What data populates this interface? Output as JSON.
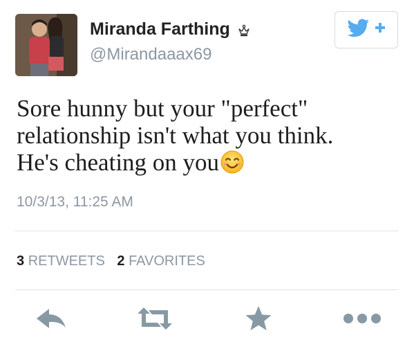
{
  "tweet": {
    "user": {
      "name": "Miranda Farthing",
      "handle": "@Mirandaaax69"
    },
    "text_lines": [
      "Sore hunny but your \"perfect\"",
      "relationship isn't what you think.",
      "He's cheating on you"
    ],
    "timestamp": "10/3/13, 11:25 AM",
    "stats": {
      "retweets_count": "3",
      "retweets_label": "RETWEETS",
      "favorites_count": "2",
      "favorites_label": "FAVORITES"
    }
  },
  "icons": {
    "follow": "twitter-bird-plus-icon",
    "badge": "crown-icon",
    "emoji": "smiling-face-emoji",
    "reply": "reply-icon",
    "retweet": "retweet-icon",
    "favorite": "star-icon",
    "more": "more-dots-icon"
  },
  "colors": {
    "twitter_blue": "#55acee",
    "action_gray": "#8899a6",
    "muted_text": "#8c97a3"
  }
}
